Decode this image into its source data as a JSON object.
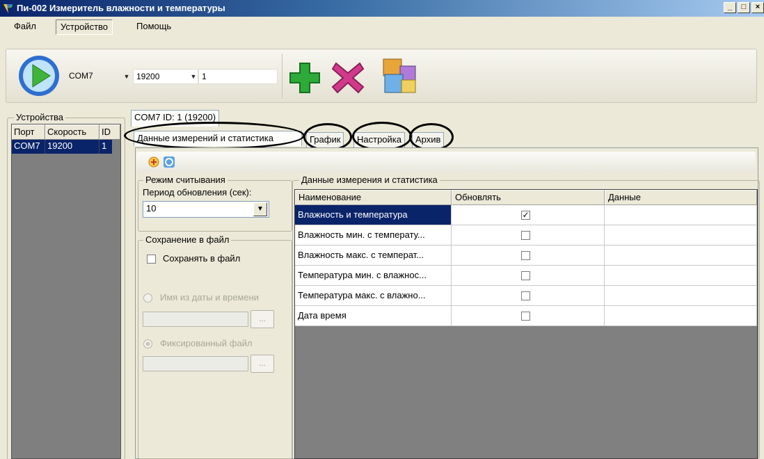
{
  "window": {
    "title": "Пи-002 Измеритель влажности и температуры",
    "controls": {
      "minimize": "_",
      "maximize": "□",
      "close": "×"
    }
  },
  "menu": {
    "items": [
      "Файл",
      "Устройство",
      "Помощь"
    ]
  },
  "toolbar": {
    "port": "COM7",
    "baud": "19200",
    "address": "1",
    "icons": [
      "play-icon",
      "add-icon",
      "delete-icon",
      "cubes-icon"
    ]
  },
  "devices": {
    "group_label": "Устройства",
    "columns": [
      "Порт",
      "Скорость",
      "ID"
    ],
    "rows": [
      {
        "port": "COM7",
        "speed": "19200",
        "id": "1"
      }
    ]
  },
  "device_tab": "COM7 ID: 1 (19200)",
  "tabs": [
    "Данные измерений и статистика",
    "График",
    "Настройка",
    "Архив"
  ],
  "read_mode": {
    "group_label": "Режим считывания",
    "period_label": "Период обновления (сек):",
    "period_value": "10"
  },
  "save": {
    "group_label": "Сохранение в файл",
    "checkbox_label": "Сохранять в файл",
    "radio_date_label": "Имя из даты и времени",
    "radio_fixed_label": "Фиксированный файл",
    "browse_label": "..."
  },
  "stats": {
    "group_label": "Данные измерения и статистика",
    "columns": [
      "Наименование",
      "Обновлять",
      "Данные"
    ],
    "rows": [
      {
        "name": "Влажность и температура",
        "update": true,
        "data": ""
      },
      {
        "name": "Влажность мин. с температу...",
        "update": false,
        "data": ""
      },
      {
        "name": "Влажность макс. с температ...",
        "update": false,
        "data": ""
      },
      {
        "name": "Температура мин. с влажнос...",
        "update": false,
        "data": ""
      },
      {
        "name": "Температура макс. с влажно...",
        "update": false,
        "data": ""
      },
      {
        "name": "Дата время",
        "update": false,
        "data": ""
      }
    ]
  }
}
